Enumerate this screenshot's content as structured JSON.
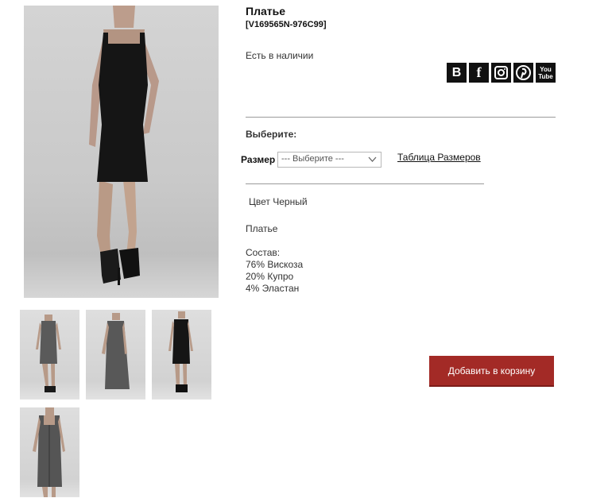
{
  "product": {
    "title": "Платье",
    "sku": "[V169565N-976C99]",
    "stock": "Есть в наличии",
    "choose_label": "Выберите:",
    "size_label": "Размер",
    "size_selected": "--- Выберите ---",
    "size_table_link": "Таблица Размеров",
    "color_text": "Цвет Черный",
    "description": "Платье",
    "composition_title": "Состав:",
    "composition": [
      "76% Вискоза",
      "20% Купро",
      "4% Эластан"
    ],
    "add_to_cart": "Добавить в корзину"
  },
  "social": [
    {
      "name": "vk-icon",
      "glyph": "B"
    },
    {
      "name": "facebook-icon",
      "glyph": "f"
    },
    {
      "name": "instagram-icon",
      "glyph": ""
    },
    {
      "name": "pinterest-icon",
      "glyph": ""
    },
    {
      "name": "youtube-icon",
      "glyph": "You\nTube"
    }
  ],
  "colors": {
    "cart_button": "#a32a26",
    "dress_black": "#141414",
    "dress_grey": "#555555"
  }
}
